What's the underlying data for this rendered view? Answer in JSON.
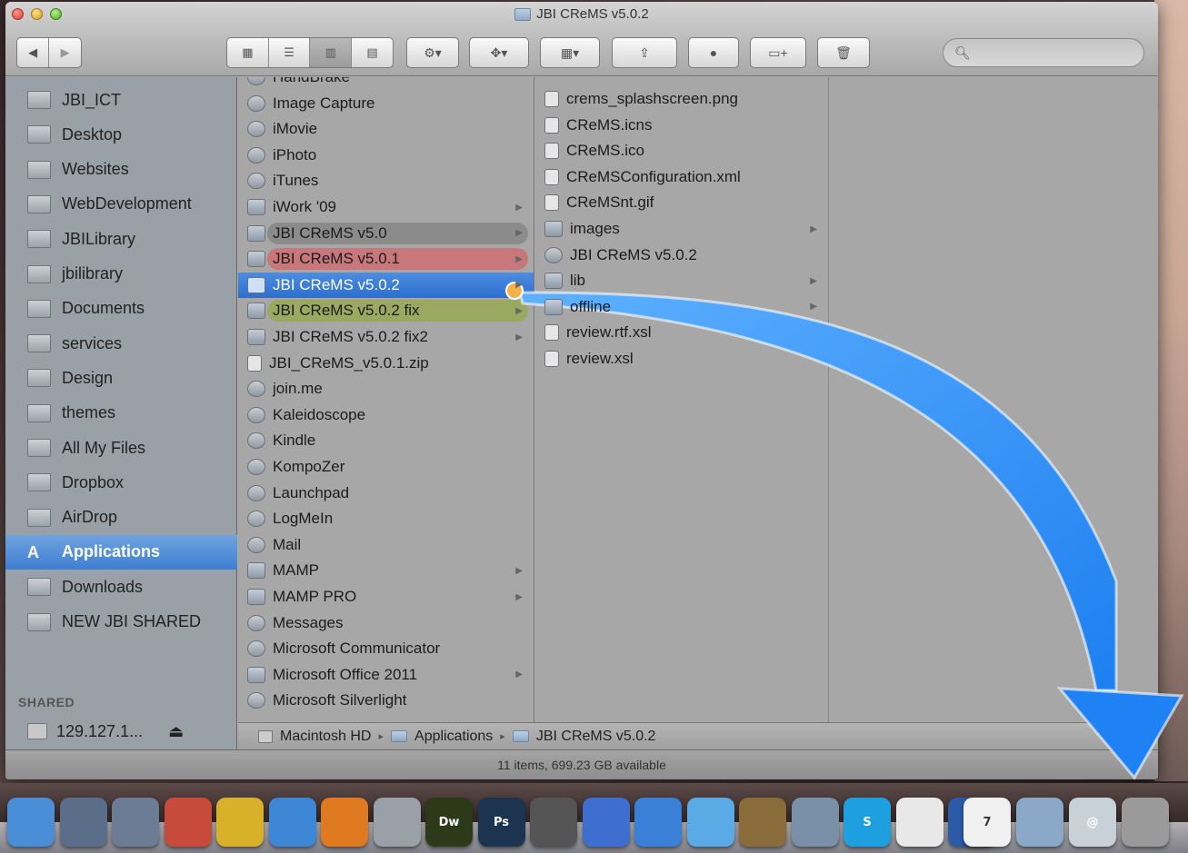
{
  "window": {
    "title": "JBI CReMS v5.0.2",
    "search_placeholder": ""
  },
  "sidebar": {
    "items": [
      {
        "label": "JBI_ICT",
        "icon": "home-icon"
      },
      {
        "label": "Desktop",
        "icon": "desktop-folder-icon"
      },
      {
        "label": "Websites",
        "icon": "folder-icon"
      },
      {
        "label": "WebDevelopment",
        "icon": "folder-icon"
      },
      {
        "label": "JBILibrary",
        "icon": "folder-icon"
      },
      {
        "label": "jbilibrary",
        "icon": "folder-icon"
      },
      {
        "label": "Documents",
        "icon": "documents-icon"
      },
      {
        "label": "services",
        "icon": "folder-icon"
      },
      {
        "label": "Design",
        "icon": "folder-icon"
      },
      {
        "label": "themes",
        "icon": "folder-icon"
      },
      {
        "label": "All My Files",
        "icon": "all-files-icon"
      },
      {
        "label": "Dropbox",
        "icon": "dropbox-icon"
      },
      {
        "label": "AirDrop",
        "icon": "airdrop-icon"
      },
      {
        "label": "Applications",
        "icon": "applications-icon",
        "selected": true
      },
      {
        "label": "Downloads",
        "icon": "downloads-icon"
      },
      {
        "label": "NEW JBI SHARED",
        "icon": "folder-icon"
      }
    ],
    "shared_heading": "SHARED",
    "shared_item": "129.127.1...",
    "eject_glyph": "⏏"
  },
  "column2": {
    "items": [
      {
        "label": "HandBrake",
        "kind": "app"
      },
      {
        "label": "Image Capture",
        "kind": "app"
      },
      {
        "label": "iMovie",
        "kind": "app"
      },
      {
        "label": "iPhoto",
        "kind": "app"
      },
      {
        "label": "iTunes",
        "kind": "app"
      },
      {
        "label": "iWork '09",
        "kind": "folder",
        "arrow": true
      },
      {
        "label": "JBI CReMS v5.0",
        "kind": "folder",
        "arrow": true,
        "tag": "#8b8b8b"
      },
      {
        "label": "JBI CReMS v5.0.1",
        "kind": "folder",
        "arrow": true,
        "tag": "#c8787a"
      },
      {
        "label": "JBI CReMS v5.0.2",
        "kind": "folder",
        "arrow": true,
        "selected": true
      },
      {
        "label": "JBI CReMS v5.0.2 fix",
        "kind": "folder",
        "arrow": true,
        "tag": "#9aa860"
      },
      {
        "label": "JBI CReMS v5.0.2 fix2",
        "kind": "folder",
        "arrow": true
      },
      {
        "label": "JBI_CReMS_v5.0.1.zip",
        "kind": "file"
      },
      {
        "label": "join.me",
        "kind": "app"
      },
      {
        "label": "Kaleidoscope",
        "kind": "app"
      },
      {
        "label": "Kindle",
        "kind": "app"
      },
      {
        "label": "KompoZer",
        "kind": "app"
      },
      {
        "label": "Launchpad",
        "kind": "app"
      },
      {
        "label": "LogMeIn",
        "kind": "app"
      },
      {
        "label": "Mail",
        "kind": "app"
      },
      {
        "label": "MAMP",
        "kind": "folder",
        "arrow": true
      },
      {
        "label": "MAMP PRO",
        "kind": "folder",
        "arrow": true
      },
      {
        "label": "Messages",
        "kind": "app"
      },
      {
        "label": "Microsoft Communicator",
        "kind": "app"
      },
      {
        "label": "Microsoft Office 2011",
        "kind": "folder",
        "arrow": true
      },
      {
        "label": "Microsoft Silverlight",
        "kind": "app"
      }
    ]
  },
  "column3": {
    "items": [
      {
        "label": "crems_splashscreen.png",
        "kind": "file"
      },
      {
        "label": "CReMS.icns",
        "kind": "file"
      },
      {
        "label": "CReMS.ico",
        "kind": "file"
      },
      {
        "label": "CReMSConfiguration.xml",
        "kind": "file"
      },
      {
        "label": "CReMSnt.gif",
        "kind": "file"
      },
      {
        "label": "images",
        "kind": "folder",
        "arrow": true
      },
      {
        "label": "JBI CReMS v5.0.2",
        "kind": "app"
      },
      {
        "label": "lib",
        "kind": "folder",
        "arrow": true
      },
      {
        "label": "offline",
        "kind": "folder",
        "arrow": true
      },
      {
        "label": "review.rtf.xsl",
        "kind": "file"
      },
      {
        "label": "review.xsl",
        "kind": "file"
      }
    ]
  },
  "pathbar": {
    "segments": [
      "Macintosh HD",
      "Applications",
      "JBI CReMS v5.0.2"
    ],
    "separator": "▸"
  },
  "status": {
    "text": "11 items, 699.23 GB available"
  },
  "toolbar": {
    "back": "◀",
    "forward": "▶"
  },
  "dock": {
    "items": [
      {
        "name": "finder",
        "color": "#4a8ed8",
        "label": ""
      },
      {
        "name": "launchpad",
        "color": "#5a6e8a",
        "label": ""
      },
      {
        "name": "vmware",
        "color": "#6d7c95",
        "label": ""
      },
      {
        "name": "parallels",
        "color": "#c84a3a",
        "label": ""
      },
      {
        "name": "chrome",
        "color": "#d8b02a",
        "label": ""
      },
      {
        "name": "safari",
        "color": "#3e86d6",
        "label": ""
      },
      {
        "name": "firefox",
        "color": "#e07a20",
        "label": ""
      },
      {
        "name": "sequel",
        "color": "#9aa0a8",
        "label": ""
      },
      {
        "name": "dreamweaver",
        "color": "#2d3a1a",
        "label": "Dw"
      },
      {
        "name": "photoshop",
        "color": "#1d3450",
        "label": "Ps"
      },
      {
        "name": "facetime",
        "color": "#555",
        "label": ""
      },
      {
        "name": "itunes",
        "color": "#3e6fd0",
        "label": ""
      },
      {
        "name": "app-store",
        "color": "#3b80d8",
        "label": ""
      },
      {
        "name": "messages",
        "color": "#5aaae6",
        "label": ""
      },
      {
        "name": "iphoto",
        "color": "#8a6b3a",
        "label": ""
      },
      {
        "name": "preview",
        "color": "#7a8fa8",
        "label": ""
      },
      {
        "name": "skype",
        "color": "#1ea0e0",
        "label": "S"
      },
      {
        "name": "acrobat",
        "color": "#e8e8e8",
        "label": ""
      },
      {
        "name": "word",
        "color": "#2b5aa8",
        "label": "W"
      },
      {
        "name": "calendar",
        "color": "#f0f0f0",
        "label": "7"
      },
      {
        "name": "documents-stack",
        "color": "#8aa8c8",
        "label": ""
      },
      {
        "name": "mail-stack",
        "color": "#c8d0d8",
        "label": "@"
      },
      {
        "name": "trash",
        "color": "#9a9a9a",
        "label": ""
      }
    ]
  }
}
